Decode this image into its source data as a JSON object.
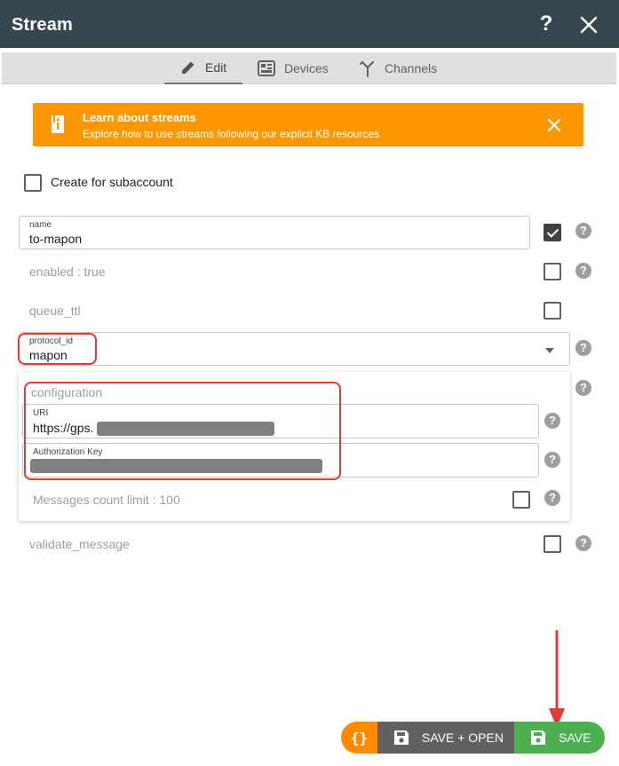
{
  "window": {
    "title": "Stream"
  },
  "tabs": [
    {
      "label": "Edit",
      "icon": "pencil-icon",
      "active": true
    },
    {
      "label": "Devices",
      "icon": "devices-icon",
      "active": false
    },
    {
      "label": "Channels",
      "icon": "channels-icon",
      "active": false
    }
  ],
  "banner": {
    "title": "Learn about streams",
    "subtitle": "Explore how to use streams following our explicit KB resources",
    "color": "#ff9800"
  },
  "form": {
    "create_subaccount_label": "Create for subaccount",
    "name": {
      "label": "name",
      "value": "to-mapon",
      "checked": true
    },
    "enabled": {
      "label": "enabled : true",
      "checked": false
    },
    "queue_ttl": {
      "label": "queue_ttl",
      "checked": false
    },
    "protocol": {
      "label": "protocol_id",
      "value": "mapon"
    },
    "configuration": {
      "title": "configuration",
      "uri": {
        "label": "URI",
        "value": "https://gps."
      },
      "auth": {
        "label": "Authorization Key",
        "value": ""
      },
      "messages_limit": {
        "label": "Messages count limit : 100",
        "checked": false
      }
    },
    "validate_message": {
      "label": "validate_message",
      "checked": false
    }
  },
  "buttons": {
    "json_label": "{}",
    "save_open_label": "SAVE + OPEN",
    "save_label": "SAVE"
  },
  "colors": {
    "header": "#37474f",
    "accent_orange": "#ff8a00",
    "save_green": "#4caf50",
    "annotation_red": "#e53935"
  }
}
